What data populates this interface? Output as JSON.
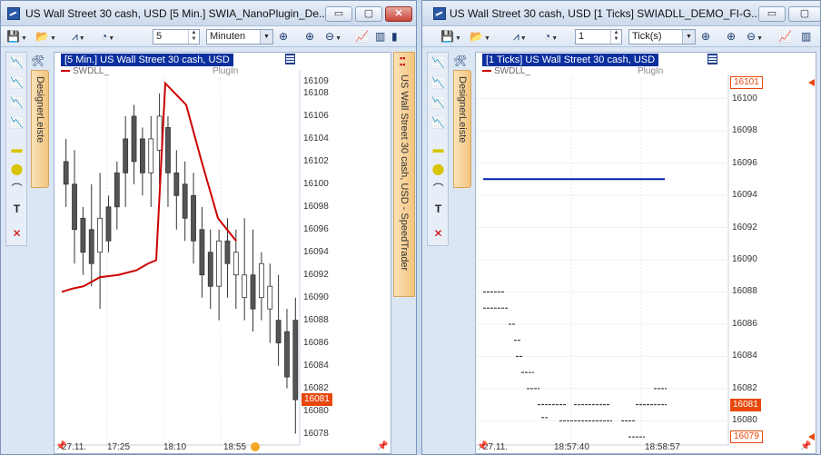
{
  "left_window": {
    "title": "US Wall Street 30 cash, USD [5 Min.]  SWIA_NanoPlugin_De...",
    "controls": {
      "minimize": "▭",
      "maximize": "▢",
      "close": "✕"
    },
    "toolbar": {
      "period_value": "5",
      "period_unit": "Minuten"
    },
    "chart_header": "[5 Min.] US Wall Street 30 cash, USD",
    "legend_name": "SWDLL_",
    "legend_plugin": "PlugIn",
    "designer_label": "DesignerLeiste",
    "vertical_tab_label": "US Wall Street 30 cash, USD - SpeedTrader",
    "price_labels": [
      "16109",
      "16108",
      "16106",
      "16104",
      "16102",
      "16100",
      "16098",
      "16096",
      "16094",
      "16092",
      "16090",
      "16088",
      "16086",
      "16084",
      "16082",
      "16080",
      "16078"
    ],
    "price_tag": "16081",
    "time_labels": [
      "27.11.",
      "17:25",
      "18:10",
      "18:55"
    ]
  },
  "right_window": {
    "title": "US Wall Street 30 cash, USD [1 Ticks]  SWIADLL_DEMO_FI-G...",
    "controls": {
      "minimize": "▭",
      "maximize": "▢"
    },
    "toolbar": {
      "period_value": "1",
      "period_unit": "Tick(s)"
    },
    "chart_header": "[1 Ticks] US Wall Street 30 cash, USD",
    "legend_name": "SWDLL_",
    "legend_plugin": "PlugIn",
    "designer_label": "DesignerLeiste",
    "price_labels": [
      "16100",
      "16098",
      "16096",
      "16094",
      "16092",
      "16090",
      "16088",
      "16086",
      "16084",
      "16082",
      "16080"
    ],
    "price_tag_top": "16101",
    "price_tag_current": "16081",
    "price_tag_bottom": "16079",
    "time_labels": [
      "27.11.",
      "18:57:40",
      "18:58:57"
    ]
  },
  "colors": {
    "candles": "#333333",
    "indicator_line": "#cc0000",
    "level_line": "#0022aa",
    "price_tag": "#e8470d",
    "header_bg": "#0b2f9e"
  },
  "chart_data": [
    {
      "type": "candlestick",
      "title": "[5 Min.] US Wall Street 30 cash, USD",
      "x": [
        "27.11.",
        "17:25",
        "18:10",
        "18:55"
      ],
      "ylim": [
        16077,
        16110
      ],
      "series": [
        {
          "name": "SWDLL_",
          "type": "line",
          "values": [
            16090.5,
            16090.8,
            16091,
            16091.8,
            16092,
            16092.4,
            16093,
            16093.3,
            16108.9,
            16107,
            16102,
            16097,
            16095
          ]
        }
      ],
      "last_price": 16081
    },
    {
      "type": "line",
      "title": "[1 Ticks] US Wall Street 30 cash, USD",
      "x": [
        "27.11.",
        "18:57:40",
        "18:58:57"
      ],
      "ylim": [
        16078.5,
        16101.5
      ],
      "series": [
        {
          "name": "level",
          "values": [
            16095,
            16095
          ]
        }
      ],
      "last_price": 16081,
      "range_high": 16101,
      "range_low": 16079
    }
  ]
}
